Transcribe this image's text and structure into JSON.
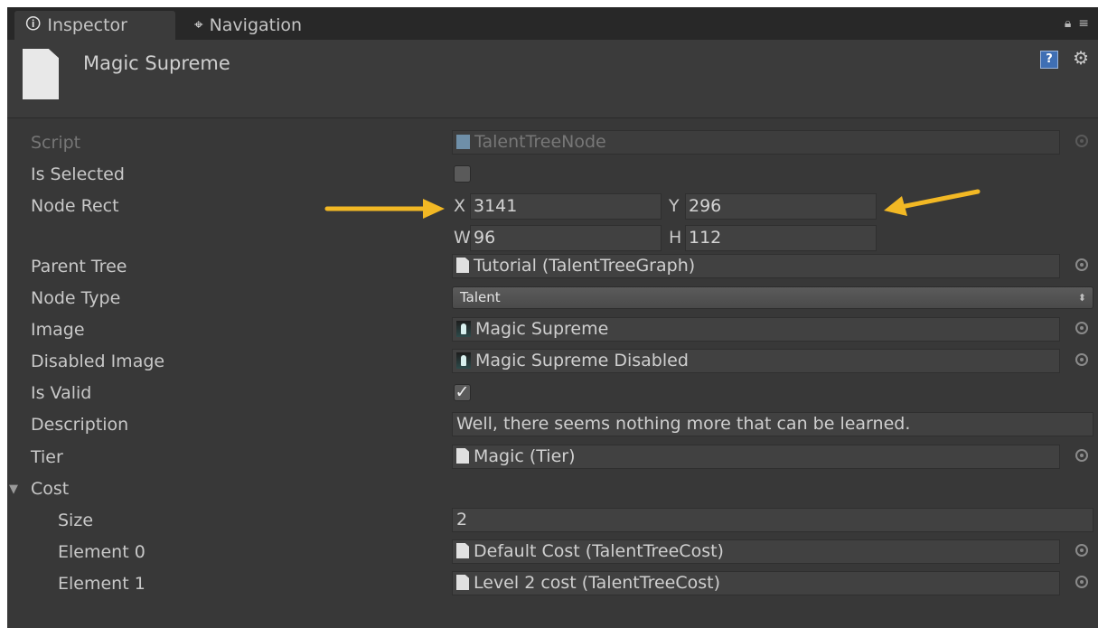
{
  "tabs": [
    {
      "label": "Inspector",
      "icon": "info-icon"
    },
    {
      "label": "Navigation",
      "icon": "navigation-icon"
    }
  ],
  "header": {
    "title": "Magic Supreme",
    "help_icon": "?",
    "settings_icon": "gear-icon"
  },
  "fields": {
    "script": {
      "label": "Script",
      "value": "TalentTreeNode"
    },
    "is_selected": {
      "label": "Is Selected",
      "checked": false
    },
    "node_rect": {
      "label": "Node Rect",
      "x_label": "X",
      "x": "3141",
      "y_label": "Y",
      "y": "296",
      "w_label": "W",
      "w": "96",
      "h_label": "H",
      "h": "112"
    },
    "parent_tree": {
      "label": "Parent Tree",
      "value": "Tutorial (TalentTreeGraph)"
    },
    "node_type": {
      "label": "Node Type",
      "value": "Talent"
    },
    "image": {
      "label": "Image",
      "value": "Magic Supreme"
    },
    "disabled_image": {
      "label": "Disabled Image",
      "value": "Magic Supreme Disabled"
    },
    "is_valid": {
      "label": "Is Valid",
      "checked": true,
      "check_glyph": "✓"
    },
    "description": {
      "label": "Description",
      "value": "Well, there seems nothing more that can be learned."
    },
    "tier": {
      "label": "Tier",
      "value": "Magic (Tier)"
    },
    "cost": {
      "label": "Cost",
      "size_label": "Size",
      "size": "2",
      "elements": [
        {
          "label": "Element 0",
          "value": "Default Cost (TalentTreeCost)"
        },
        {
          "label": "Element 1",
          "value": "Level 2 cost (TalentTreeCost)"
        }
      ]
    }
  },
  "colors": {
    "panel": "#383838",
    "tabbar": "#282828",
    "annotation_arrow": "#f2b824"
  }
}
